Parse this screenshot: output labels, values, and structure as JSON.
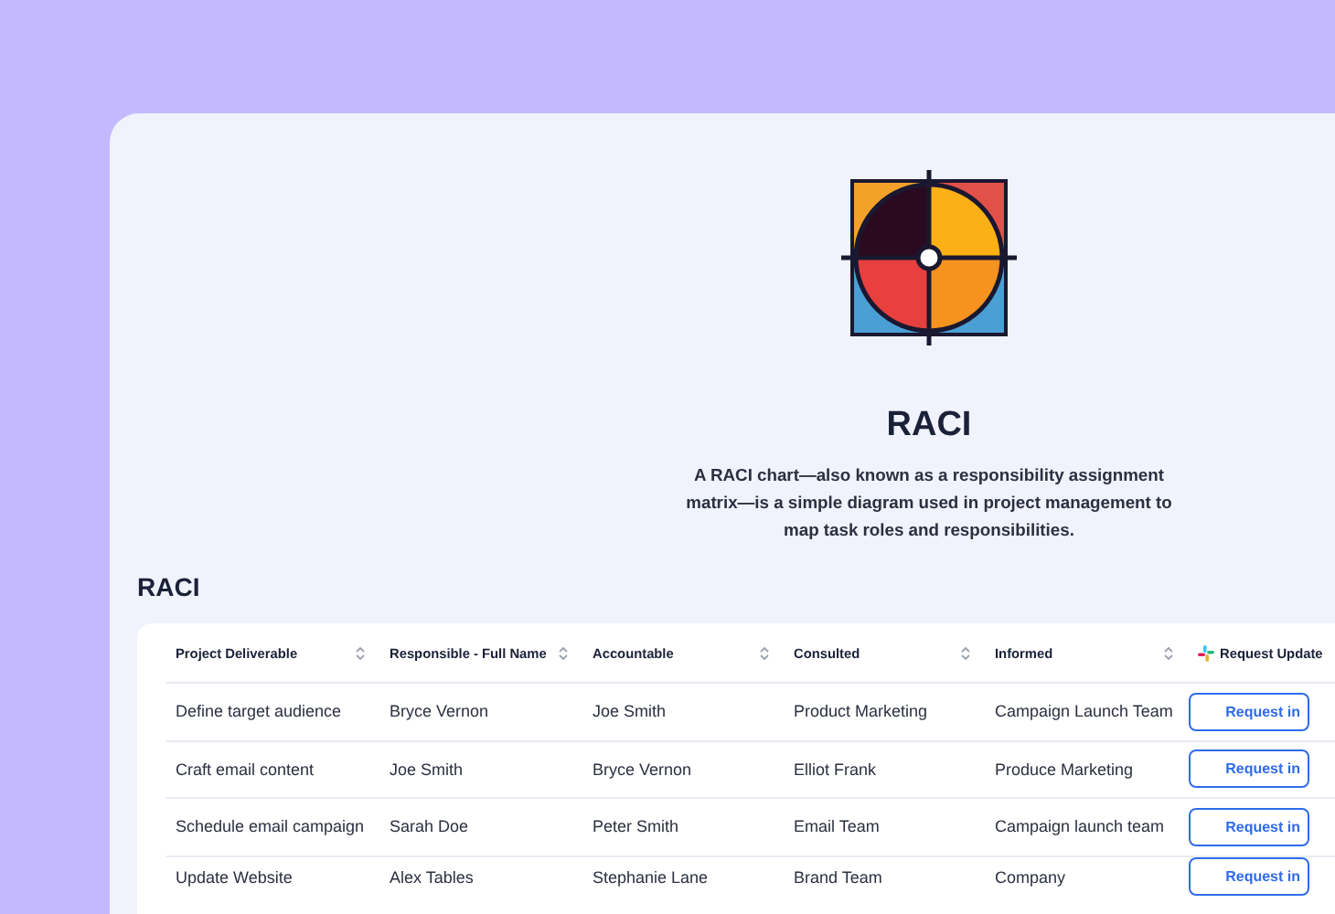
{
  "hero": {
    "title": "RACI",
    "description": "A RACI chart—also known as a responsibility assignment matrix—is a simple diagram used in project management to map task roles and responsibilities."
  },
  "section_title": "RACI",
  "table": {
    "columns": [
      {
        "label": "Project Deliverable",
        "kind": "sortable"
      },
      {
        "label": "Responsible - Full Name",
        "kind": "sortable"
      },
      {
        "label": "Accountable",
        "kind": "sortable"
      },
      {
        "label": "Consulted",
        "kind": "sortable"
      },
      {
        "label": "Informed",
        "kind": "sortable"
      },
      {
        "label": "Request Update",
        "kind": "action"
      }
    ],
    "rows": [
      {
        "cells": [
          "Define target audience",
          "Bryce Vernon",
          "Joe Smith",
          "Product Marketing",
          "Campaign Launch Team"
        ],
        "action": "Request in"
      },
      {
        "cells": [
          "Craft email content",
          "Joe Smith",
          "Bryce Vernon",
          "Elliot Frank",
          "Produce Marketing"
        ],
        "action": "Request in"
      },
      {
        "cells": [
          "Schedule email campaign",
          "Sarah Doe",
          "Peter Smith",
          "Email Team",
          "Campaign launch team"
        ],
        "action": "Request in"
      },
      {
        "cells": [
          "Update Website",
          "Alex Tables",
          "Stephanie Lane",
          "Brand Team",
          "Company"
        ],
        "action": "Request in"
      }
    ]
  }
}
